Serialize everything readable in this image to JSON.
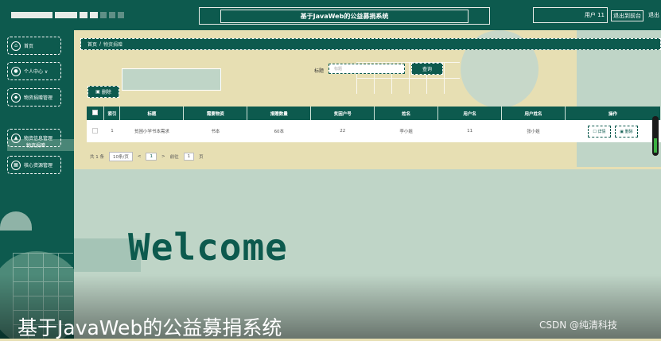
{
  "header": {
    "title": "基于JavaWeb的公益募捐系统",
    "user_label": "用户 11",
    "backend_link": "退出到前台",
    "logout_link": "退出"
  },
  "sidebar": {
    "items": [
      {
        "label": "首页",
        "icon": "home-icon"
      },
      {
        "label": "个人中心 ∨",
        "icon": "user-icon"
      },
      {
        "label": "物资捐赠管理",
        "icon": "gift-icon"
      },
      {
        "label": "物资信息管理",
        "icon": "box-icon"
      },
      {
        "label": "核心资源管理",
        "icon": "grid-icon"
      }
    ],
    "active_sub": "物资捐赠"
  },
  "breadcrumb": {
    "home": "首页",
    "sep": "/",
    "current": "物资捐赠"
  },
  "search": {
    "label": "标题",
    "placeholder": "标题",
    "button": "查询"
  },
  "actions": {
    "delete": "删除"
  },
  "table": {
    "headers": [
      "索引",
      "标题",
      "需要物资",
      "捐赠数量",
      "贫困户号",
      "姓名",
      "用户名",
      "用户姓名",
      "操作"
    ],
    "rows": [
      {
        "index": "1",
        "title": "贫困小学书本需求",
        "need": "书本",
        "qty": "60本",
        "household": "22",
        "name": "李小姐",
        "username": "11",
        "user_fullname": "张小姐"
      }
    ],
    "op_detail": "详情",
    "op_delete": "删除"
  },
  "pager": {
    "total": "共 1 条",
    "per_page": "10条/页",
    "prev": "<",
    "page": "1",
    "next": ">",
    "goto": "前往",
    "goto_page": "1",
    "page_unit": "页"
  },
  "welcome": "Welcome",
  "video": {
    "caption": "基于JavaWeb的公益募捐系统",
    "watermark": "CSDN @纯清科技"
  },
  "colors": {
    "primary": "#0d5a4e",
    "background": "#e7dfb3",
    "accent_light": "#bfd5c7"
  }
}
